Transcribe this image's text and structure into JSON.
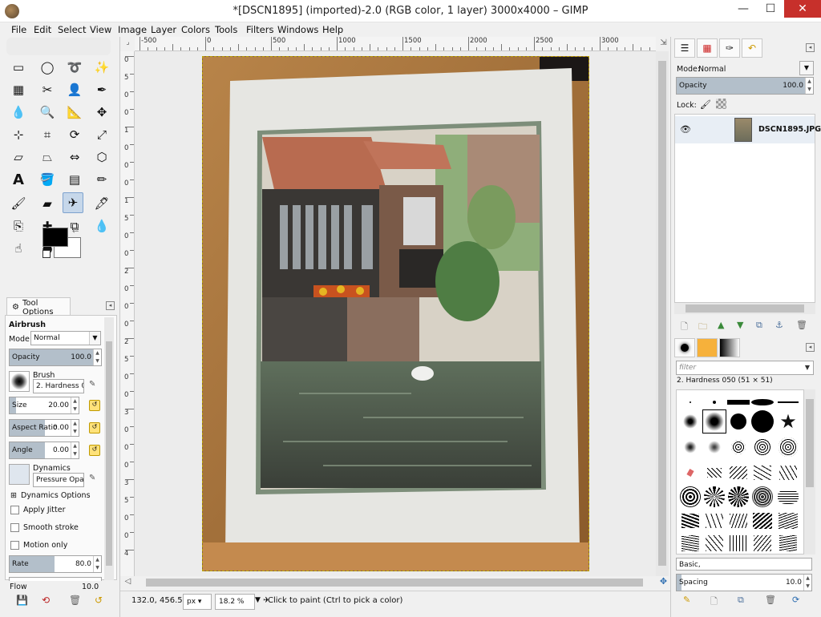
{
  "window": {
    "title": "*[DSCN1895] (imported)-2.0 (RGB color, 1 layer) 3000x4000 – GIMP",
    "minimize": "—",
    "maximize": "☐",
    "close": "✕"
  },
  "menu": [
    "File",
    "Edit",
    "Select",
    "View",
    "Image",
    "Layer",
    "Colors",
    "Tools",
    "Filters",
    "Windows",
    "Help"
  ],
  "toolbox": {
    "tools": [
      "rect-select",
      "ellipse-select",
      "free-select",
      "fuzzy-select",
      "select-by-color",
      "scissors",
      "foreground-select",
      "paths",
      "color-picker",
      "zoom",
      "measure",
      "move",
      "align",
      "crop",
      "rotate",
      "scale",
      "shear",
      "perspective",
      "flip",
      "cage-transform",
      "text",
      "bucket-fill",
      "blend",
      "pencil",
      "paintbrush",
      "eraser",
      "airbrush",
      "ink",
      "clone",
      "heal",
      "perspective-clone",
      "blur",
      "smudge",
      "dodge-burn"
    ],
    "fg_color": "#000000",
    "bg_color": "#ffffff"
  },
  "tool_options": {
    "tab_label": "Tool Options",
    "tool_name": "Airbrush",
    "mode_label": "Mode:",
    "mode_value": "Normal",
    "opacity_label": "Opacity",
    "opacity_value": "100.0",
    "brush_label": "Brush",
    "brush_value": "2. Hardness 050",
    "size_label": "Size",
    "size_value": "20.00",
    "aspect_label": "Aspect Ratio",
    "aspect_value": "0.00",
    "angle_label": "Angle",
    "angle_value": "0.00",
    "dynamics_label": "Dynamics",
    "dynamics_value": "Pressure Opacity",
    "dynamics_options": "Dynamics Options",
    "apply_jitter": "Apply Jitter",
    "smooth_stroke": "Smooth stroke",
    "motion_only": "Motion only",
    "rate_label": "Rate",
    "rate_value": "80.0",
    "flow_label": "Flow",
    "flow_value": "10.0"
  },
  "rulers": {
    "h": [
      "-500",
      "0",
      "500",
      "1000",
      "1500",
      "2000",
      "2500",
      "3000",
      "3500"
    ],
    "v": [
      "0",
      "5",
      "0",
      "0",
      "1",
      "0",
      "0",
      "0",
      "1",
      "5",
      "0",
      "0",
      "2",
      "0",
      "0",
      "0",
      "2",
      "5",
      "0",
      "0",
      "3",
      "0",
      "0",
      "0",
      "3",
      "5",
      "0",
      "0",
      "4"
    ]
  },
  "status": {
    "coords": "132.0, 456.5",
    "unit": "px",
    "zoom": "18.2 %",
    "message": "Click to paint (Ctrl to pick a color)"
  },
  "layers": {
    "mode_label": "Mode:",
    "mode_value": "Normal",
    "opacity_label": "Opacity",
    "opacity_value": "100.0",
    "lock_label": "Lock:",
    "layer_name": "DSCN1895.JPG"
  },
  "brushes": {
    "filter_placeholder": "filter",
    "current": "2. Hardness 050 (51 × 51)",
    "preset": "Basic,",
    "spacing_label": "Spacing",
    "spacing_value": "10.0"
  }
}
